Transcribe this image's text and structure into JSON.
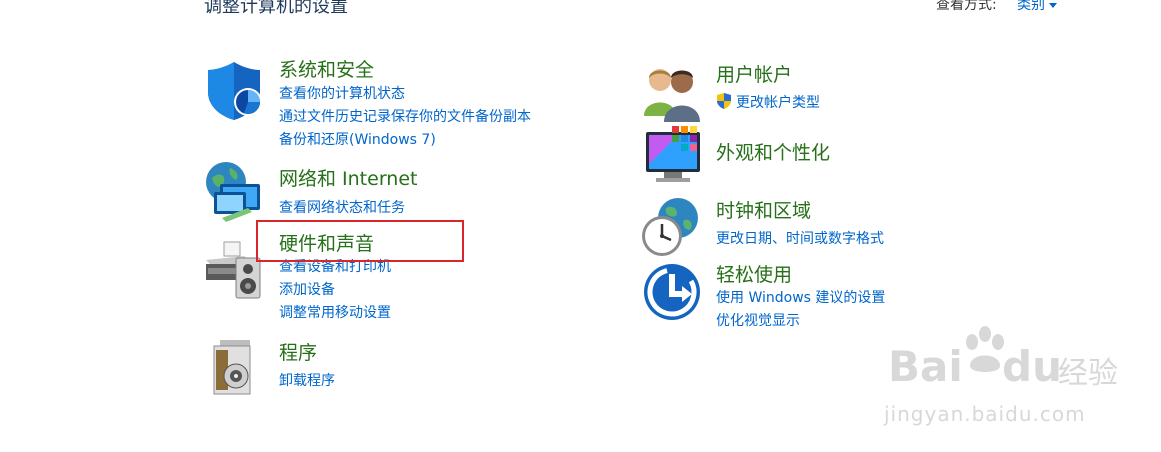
{
  "header": {
    "title": "调整计算机的设置",
    "view_label": "查看方式:",
    "view_value": "类别"
  },
  "categories": {
    "system_security": {
      "title": "系统和安全",
      "links": [
        "查看你的计算机状态",
        "通过文件历史记录保存你的文件备份副本",
        "备份和还原(Windows 7)"
      ]
    },
    "network": {
      "title": "网络和 Internet",
      "links": [
        "查看网络状态和任务"
      ]
    },
    "hardware_sound": {
      "title": "硬件和声音",
      "links": [
        "查看设备和打印机",
        "添加设备",
        "调整常用移动设置"
      ]
    },
    "programs": {
      "title": "程序",
      "links": [
        "卸载程序"
      ]
    },
    "user_accounts": {
      "title": "用户帐户",
      "links": [
        "更改帐户类型"
      ]
    },
    "appearance": {
      "title": "外观和个性化",
      "links": []
    },
    "clock_region": {
      "title": "时钟和区域",
      "links": [
        "更改日期、时间或数字格式"
      ]
    },
    "ease_of_access": {
      "title": "轻松使用",
      "links": [
        "使用 Windows 建议的设置",
        "优化视觉显示"
      ]
    }
  },
  "watermark": {
    "brand_left": "Bai",
    "brand_right": "du",
    "brand_cn": "经验",
    "url": "jingyan.baidu.com"
  },
  "colors": {
    "category_title": "#267019",
    "link": "#0066cc",
    "highlight_box": "#d9262b"
  }
}
